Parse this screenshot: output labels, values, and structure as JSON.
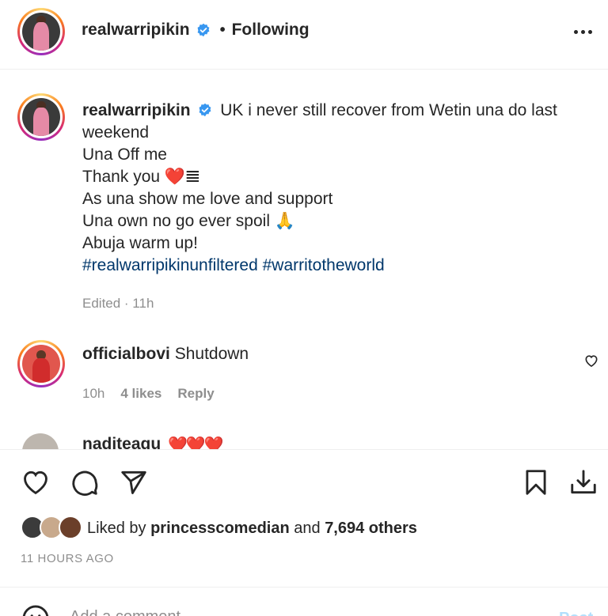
{
  "header": {
    "username": "realwarripikin",
    "separator": "•",
    "follow_status": "Following"
  },
  "caption": {
    "username": "realwarripikin",
    "lines": [
      "UK i never still recover from Wetin una do last weekend",
      "Una Off me",
      "Thank you ❤️𝌆",
      "As una show me love and support",
      "Una own no go ever spoil 🙏",
      "Abuja warm up!"
    ],
    "hashtags": [
      "#realwarripikinunfiltered",
      "#warritotheworld"
    ],
    "meta": "Edited · 11h"
  },
  "comment": {
    "username": "officialbovi",
    "text": "Shutdown",
    "time": "10h",
    "likes": "4 likes",
    "reply_label": "Reply"
  },
  "partial_comment": {
    "username": "naditeagu",
    "text": "❤️❤️❤️"
  },
  "likes": {
    "prefix": "Liked by",
    "user": "princesscomedian",
    "joiner": "and",
    "others": "7,694 others"
  },
  "timestamp": "11 HOURS AGO",
  "add_comment": {
    "placeholder": "Add a comment...",
    "post_label": "Post"
  },
  "icons": {
    "verified": "verified-badge-icon",
    "more": "more-options-icon",
    "like": "heart-icon",
    "comment": "comment-bubble-icon",
    "share": "paper-plane-icon",
    "save": "bookmark-icon",
    "download": "download-icon",
    "emoji": "emoji-smile-icon"
  },
  "colors": {
    "text": "#262626",
    "muted": "#8e8e8e",
    "hashtag": "#00376b",
    "verified": "#3897f0",
    "post_button": "#b2dffc"
  }
}
